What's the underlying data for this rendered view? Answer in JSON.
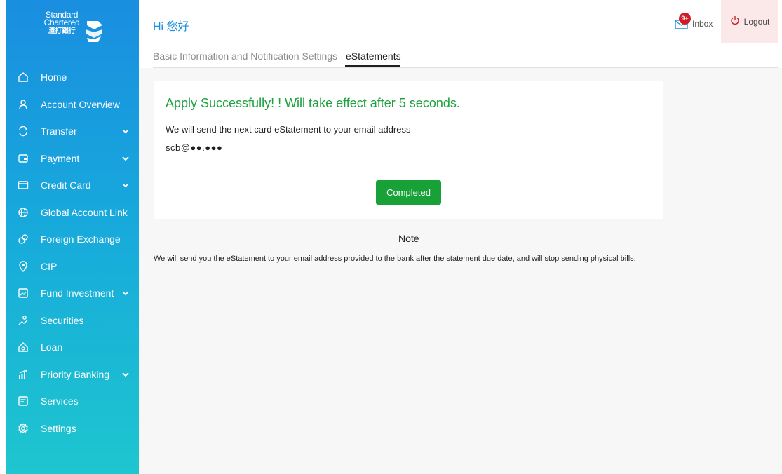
{
  "brand": {
    "line1": "Standard",
    "line2": "Chartered",
    "line3": "渣打銀行",
    "primary_color": "#1a8ee0",
    "accent_green": "#17a136"
  },
  "sidebar": {
    "items": [
      {
        "label": "Home",
        "icon": "home-icon",
        "has_chevron": false
      },
      {
        "label": "Account Overview",
        "icon": "person-icon",
        "has_chevron": false
      },
      {
        "label": "Transfer",
        "icon": "transfer-icon",
        "has_chevron": true
      },
      {
        "label": "Payment",
        "icon": "wallet-icon",
        "has_chevron": true
      },
      {
        "label": "Credit Card",
        "icon": "credit-card-icon",
        "has_chevron": true
      },
      {
        "label": "Global Account Link",
        "icon": "globe-icon",
        "has_chevron": false
      },
      {
        "label": "Foreign Exchange",
        "icon": "currency-exchange-icon",
        "has_chevron": false
      },
      {
        "label": "CIP",
        "icon": "cip-icon",
        "has_chevron": false
      },
      {
        "label": "Fund Investment",
        "icon": "chart-icon",
        "has_chevron": true
      },
      {
        "label": "Securities",
        "icon": "securities-icon",
        "has_chevron": false
      },
      {
        "label": "Loan",
        "icon": "loan-house-icon",
        "has_chevron": false
      },
      {
        "label": "Priority Banking",
        "icon": "priority-banking-icon",
        "has_chevron": true
      },
      {
        "label": "Services",
        "icon": "services-icon",
        "has_chevron": false
      },
      {
        "label": "Settings",
        "icon": "gear-icon",
        "has_chevron": false
      }
    ]
  },
  "header": {
    "greeting": "Hi 您好",
    "inbox_label": "Inbox",
    "inbox_badge": "9+",
    "logout_label": "Logout"
  },
  "tabs": [
    {
      "label": "Basic Information and Notification Settings",
      "active": false
    },
    {
      "label": "eStatements",
      "active": true
    }
  ],
  "card": {
    "title": "Apply Successfully! ! Will take effect after 5 seconds.",
    "message": "We will send the next card eStatement to your email address",
    "email": "scb@●●.●●●",
    "button_label": "Completed"
  },
  "note": {
    "title": "Note",
    "body": "We will send you the eStatement to your email address provided to the bank after the statement due date, and will stop sending physical bills."
  }
}
